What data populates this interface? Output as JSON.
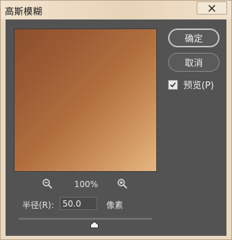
{
  "window": {
    "title": "高斯模糊",
    "close_icon": "close-icon"
  },
  "buttons": {
    "ok_label": "确定",
    "cancel_label": "取消"
  },
  "preview_toggle": {
    "label": "预览(P)",
    "checked": true
  },
  "zoom": {
    "level": "100%",
    "zoom_out_icon": "zoom-out-icon",
    "zoom_in_icon": "zoom-in-icon"
  },
  "radius": {
    "label": "半径(R):",
    "value": "50.0",
    "unit": "像素",
    "slider_position": 0.57
  },
  "colors": {
    "panel_bg": "#535353",
    "preview_start": "#8a4f2c",
    "preview_end": "#e6b680"
  }
}
